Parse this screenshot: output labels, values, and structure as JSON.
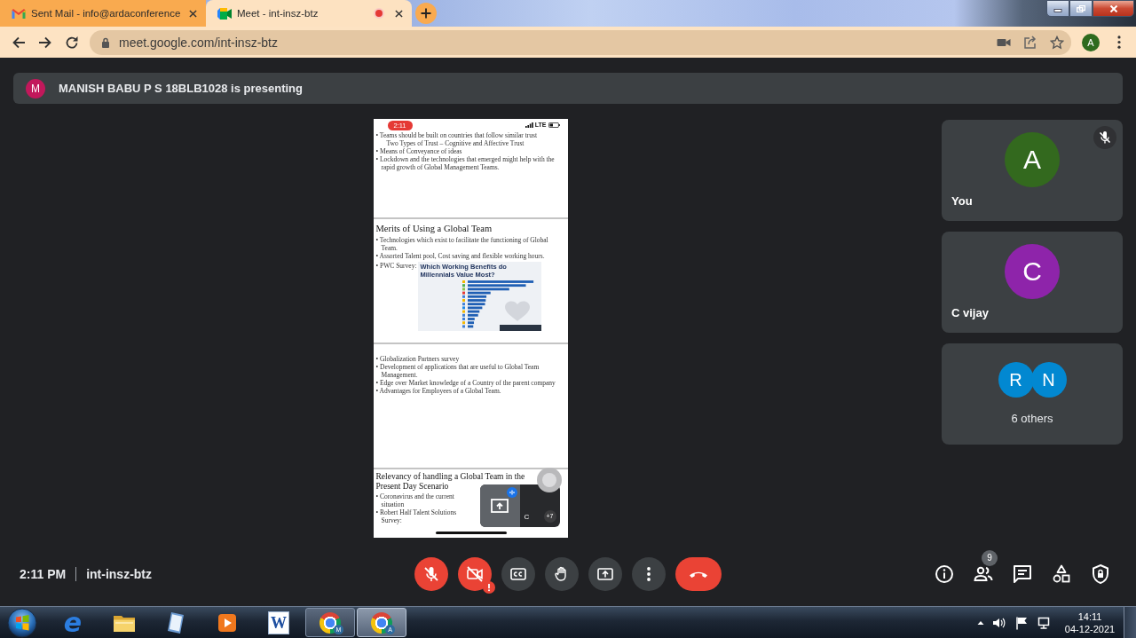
{
  "browser": {
    "tabs": [
      {
        "kind": "mail",
        "title": "Sent Mail - info@ardaconference",
        "selected": false,
        "recording": false
      },
      {
        "kind": "meet",
        "title": "Meet - int-insz-btz",
        "selected": true,
        "recording": true
      }
    ],
    "url": "meet.google.com/int-insz-btz",
    "profile_initial": "A"
  },
  "banner": {
    "initial": "M",
    "text": "MANISH BABU P S 18BLB1028 is presenting"
  },
  "shared_screen": {
    "status_time": "2:11",
    "network": "LTE",
    "slides": [
      {
        "items": [
          {
            "kind": "bullet",
            "text": "• Teams should be built on countries that follow similar trust"
          },
          {
            "kind": "sub",
            "text": "Two Types of Trust – Cognitive and Affective Trust"
          },
          {
            "kind": "bullet",
            "text": "• Means of Conveyance of ideas"
          },
          {
            "kind": "bullet",
            "text": "• Lockdown and the technologies that emerged might help with the rapid growth of Global Management Teams."
          }
        ]
      },
      {
        "items": [
          {
            "kind": "title",
            "text": "Merits of Using a Global Team"
          },
          {
            "kind": "bullet",
            "text": "• Technologies which exist to facilitate the functioning of Global Team."
          },
          {
            "kind": "bullet",
            "text": "• Assorted Talent pool, Cost saving and flexible working hours."
          },
          {
            "kind": "chart",
            "text": "• PWC Survey:",
            "title": "Which Working Benefits do Millennials Value Most?"
          }
        ]
      },
      {
        "items": [
          {
            "kind": "bullet",
            "text": "• Globalization Partners survey"
          },
          {
            "kind": "bullet",
            "text": "• Development of applications that are useful to Global Team Management."
          },
          {
            "kind": "bullet",
            "text": "• Edge over Market knowledge of a Country of the parent company"
          },
          {
            "kind": "bullet",
            "text": "• Advantages for Employees of a Global Team."
          }
        ]
      },
      {
        "items": [
          {
            "kind": "title",
            "text": "Relevancy of handling a Global Team in the Present Day Scenario"
          },
          {
            "kind": "bullet",
            "text": "• Coronavirus and the current situation"
          },
          {
            "kind": "bullet",
            "text": "• Robert Half Talent Solutions Survey:"
          }
        ]
      }
    ],
    "pip": {
      "initial": "C",
      "count": "+7"
    }
  },
  "participants": [
    {
      "initial": "A",
      "name": "You",
      "color": "#33691e",
      "muted": true
    },
    {
      "initial": "C",
      "name": "C vijay",
      "color": "#8e24aa",
      "muted": false
    }
  ],
  "others": {
    "avatars": [
      {
        "initial": "R",
        "color": "#0288d1"
      },
      {
        "initial": "N",
        "color": "#0288d1"
      }
    ],
    "label": "6 others"
  },
  "bottom_bar": {
    "time": "2:11 PM",
    "meeting_code": "int-insz-btz",
    "controls": [
      {
        "kind": "mic",
        "on": false
      },
      {
        "kind": "camera",
        "on": false,
        "alert": true
      },
      {
        "kind": "captions"
      },
      {
        "kind": "hand"
      },
      {
        "kind": "present"
      },
      {
        "kind": "more"
      },
      {
        "kind": "leave"
      }
    ],
    "people_count": "9"
  },
  "taskbar": {
    "apps": [
      {
        "kind": "ie",
        "glyph": "e",
        "running": false,
        "selected": false
      },
      {
        "kind": "folder",
        "running": false,
        "selected": false
      },
      {
        "kind": "notepad",
        "running": false,
        "selected": false
      },
      {
        "kind": "media",
        "running": false,
        "selected": false
      },
      {
        "kind": "word",
        "glyph": "W",
        "running": false,
        "selected": false
      },
      {
        "kind": "chrome",
        "badge": "M",
        "running": true,
        "selected": false
      },
      {
        "kind": "chrome",
        "badge": "A",
        "running": true,
        "selected": true
      }
    ],
    "clock_time": "14:11",
    "clock_date": "04-12-2021"
  }
}
